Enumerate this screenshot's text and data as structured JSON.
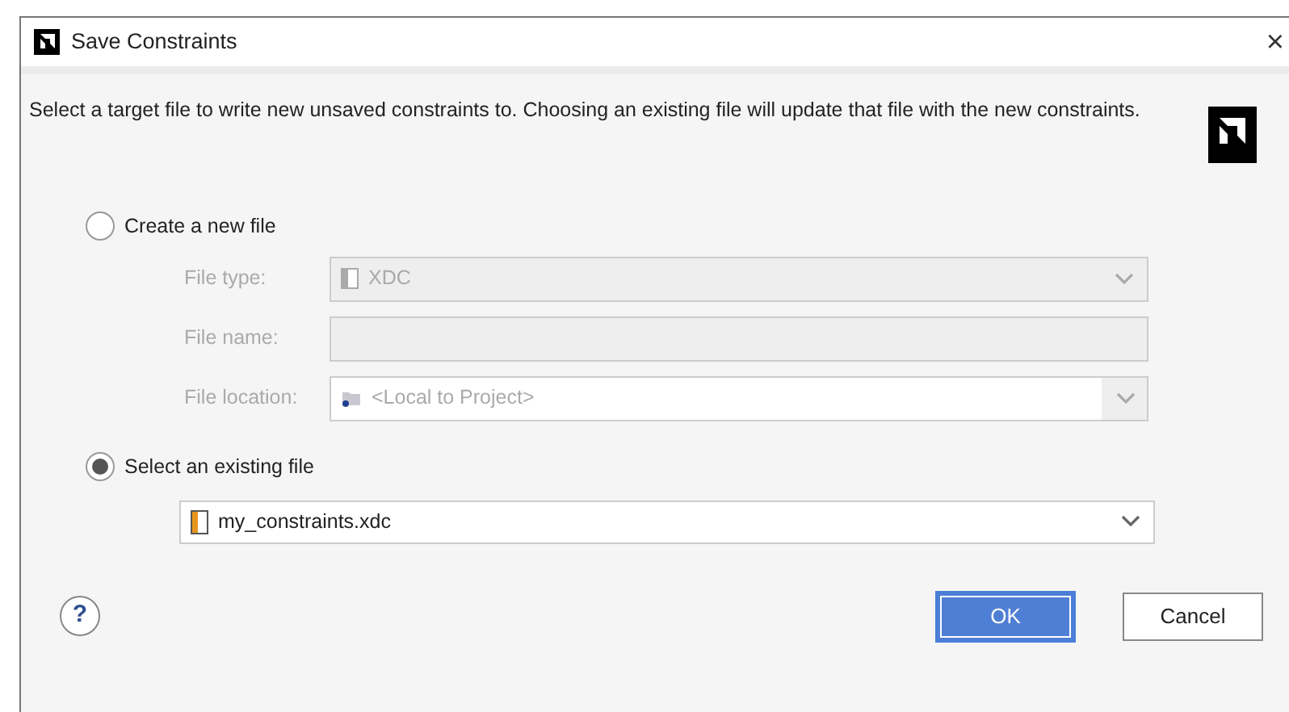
{
  "window": {
    "title": "Save Constraints",
    "close": "×"
  },
  "description": "Select a target file to write new unsaved constraints to. Choosing an existing file will update that file with the new constraints.",
  "options": [
    {
      "label": "Create a new file",
      "selected": false,
      "fields": [
        {
          "kind": "dropdown",
          "label": "File type:",
          "value": "XDC",
          "disabled": true
        },
        {
          "kind": "text",
          "label": "File name:",
          "disabled": true
        },
        {
          "kind": "combo",
          "label": "File location:",
          "value": "<Local to Project>",
          "disabled": true
        }
      ]
    },
    {
      "label": "Select an existing file",
      "selected": true,
      "fields": [
        {
          "kind": "dropdown",
          "value": "my_constraints.xdc",
          "disabled": false
        }
      ]
    }
  ],
  "buttons": [
    {
      "label": "OK",
      "kind": "primary"
    },
    {
      "label": "Cancel",
      "kind": "secondary"
    }
  ],
  "help": "?"
}
